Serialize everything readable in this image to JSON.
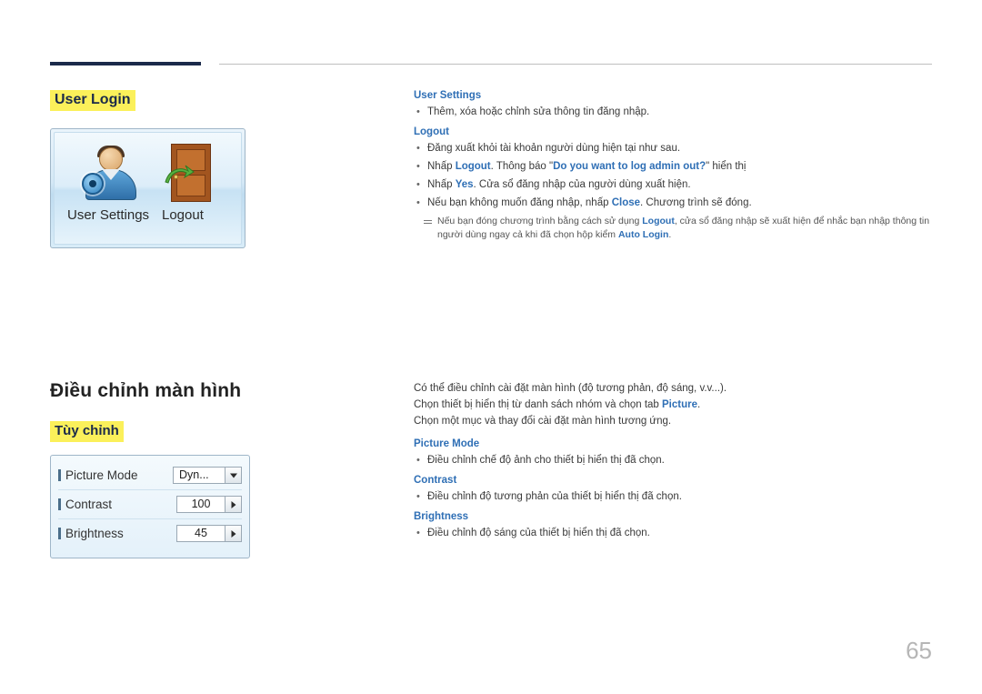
{
  "page": {
    "number": "65"
  },
  "left": {
    "user_login_heading": "User Login",
    "panel_user": {
      "user_settings_label": "User Settings",
      "logout_label": "Logout"
    },
    "section_title": "Điều chỉnh màn hình",
    "tuy_chinh_heading": "Tùy chỉnh",
    "panel_picture": {
      "rows": [
        {
          "name": "Picture Mode",
          "value": "Dyn...",
          "control": "dropdown"
        },
        {
          "name": "Contrast",
          "value": "100",
          "control": "spinner"
        },
        {
          "name": "Brightness",
          "value": "45",
          "control": "spinner"
        }
      ]
    }
  },
  "right": {
    "block1": {
      "user_settings_head": "User Settings",
      "user_settings_bullets": [
        "Thêm, xóa hoặc chỉnh sửa thông tin đăng nhập."
      ],
      "logout_head": "Logout",
      "logout_bullets": [
        "Đăng xuất khỏi tài khoản người dùng hiện tại như sau.",
        "Nhấp Logout. Thông báo \"Do you want to log admin out?\" hiển thị",
        "Nhấp Yes. Cửa sổ đăng nhập của người dùng xuất hiện.",
        "Nếu bạn không muốn đăng nhập, nhấp Close. Chương trình sẽ đóng."
      ],
      "note": "Nếu bạn đóng chương trình bằng cách sử dụng Logout, cửa sổ đăng nhập sẽ xuất hiện để nhắc bạn nhập thông tin người dùng ngay cả khi đã chọn hộp kiểm Auto Login."
    },
    "block2": {
      "intro_lines": [
        "Có thể điều chỉnh cài đặt màn hình (độ tương phản, độ sáng, v.v...).",
        "Chọn thiết bị hiển thị từ danh sách nhóm và chọn tab Picture.",
        "Chọn một mục và thay đổi cài đặt màn hình tương ứng."
      ],
      "picture_mode_head": "Picture Mode",
      "picture_mode_bullet": "Điều chỉnh chế độ ảnh cho thiết bị hiển thị đã chọn.",
      "contrast_head": "Contrast",
      "contrast_bullet": "Điều chỉnh độ tương phản của thiết bị hiển thị đã chọn.",
      "brightness_head": "Brightness",
      "brightness_bullet": "Điều chỉnh độ sáng của thiết bị hiển thị đã chọn."
    }
  },
  "colors": {
    "highlight": "#fbf05a",
    "heading_navy": "#1b2a4a",
    "link_blue": "#2f6fb5",
    "rule_dark": "#1b2a4a"
  }
}
